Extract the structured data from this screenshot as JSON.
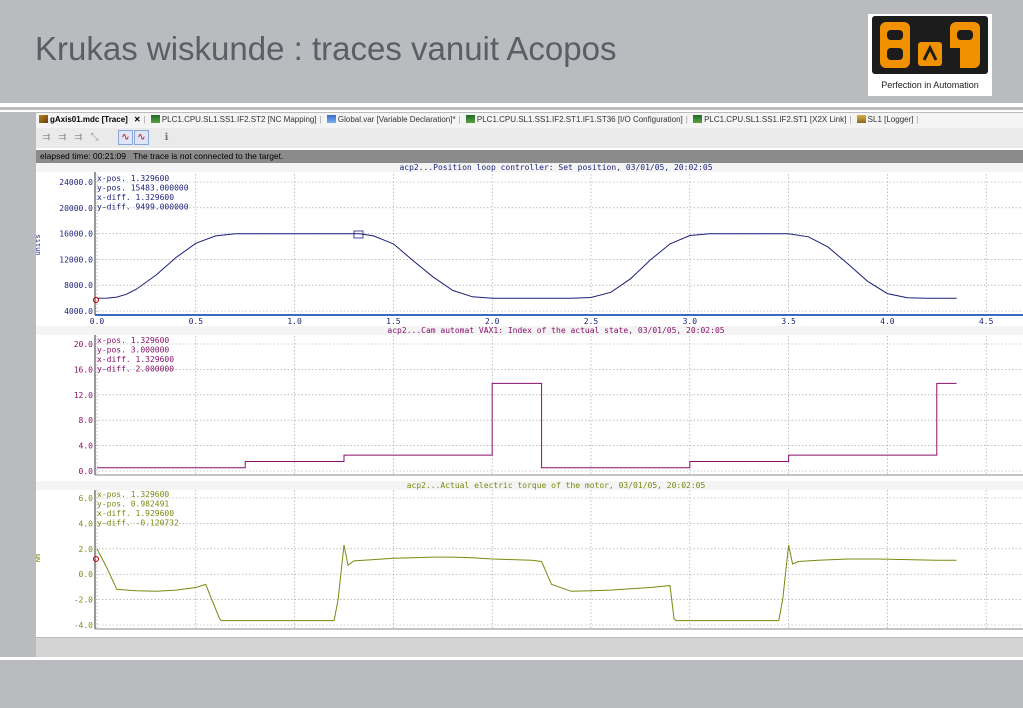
{
  "slide": {
    "title": "Krukas wiskunde : traces vanuit Acopos",
    "logo_tagline": "Perfection in Automation"
  },
  "colors": {
    "plot1": "#1a1f78",
    "plot2": "#8a0f6a",
    "plot3": "#7a8a10",
    "grid": "#9a9a9a",
    "status_bg": "#8b8b8b"
  },
  "tabs": [
    {
      "label": "gAxis01.mdc [Trace]",
      "close": "✕",
      "icon": "trace-icon",
      "active": true
    },
    {
      "label": "PLC1.CPU.SL1.SS1.IF2.ST2 [NC Mapping]",
      "icon": "hardware-icon"
    },
    {
      "label": "Global.var [Variable Declaration]*",
      "icon": "variable-icon"
    },
    {
      "label": "PLC1.CPU.SL1.SS1.IF2.ST1.IF1.ST36 [I/O Configuration]",
      "icon": "hardware-icon"
    },
    {
      "label": "PLC1.CPU.SL1.SS1.IF2.ST1 [X2X Link]",
      "icon": "hardware-icon"
    },
    {
      "label": "SL1 [Logger]",
      "icon": "logger-icon"
    }
  ],
  "toolbar": {
    "buttons": [
      "zoom-in-icon",
      "zoom-out-icon",
      "zoom-reset-icon",
      "cursor-icon",
      "wave-icon",
      "wave-red-icon",
      "info-icon"
    ]
  },
  "status": {
    "elapsed": "elapsed time: 00:21:09",
    "message": "The trace is not connected to the target."
  },
  "chart_data": [
    {
      "type": "line",
      "title": "acp2...Position loop controller: Set position, 03/01/05, 20:02:05",
      "ylabel": "units",
      "yticks": [
        "24000.0",
        "20000.0",
        "16000.0",
        "12000.0",
        "8000.0",
        "4000.0"
      ],
      "xticks": [
        "0.0",
        "0.5",
        "1.0",
        "1.5",
        "2.0",
        "2.5",
        "3.0",
        "3.5",
        "4.0",
        "4.5"
      ],
      "cursor": {
        "x-pos.": "1.329600",
        "y-pos.": "15483.000000",
        "x-diff.": "1.329600",
        "y-diff.": "9499.000000"
      },
      "xlim": [
        0,
        4.5
      ],
      "ylim": [
        4000,
        24000
      ],
      "series": [
        {
          "x": [
            0,
            0.05,
            0.1,
            0.15,
            0.2,
            0.3,
            0.4,
            0.5,
            0.6,
            0.7,
            0.8,
            0.9,
            1.0,
            1.1,
            1.2,
            1.3,
            1.33,
            1.4,
            1.5,
            1.6,
            1.7,
            1.8,
            1.9,
            2.0,
            2.1,
            2.2,
            2.3,
            2.4,
            2.5,
            2.6,
            2.7,
            2.8,
            2.9,
            3.0,
            3.1,
            3.2,
            3.3,
            3.4,
            3.5,
            3.6,
            3.7,
            3.8,
            3.9,
            4.0,
            4.1,
            4.2,
            4.35
          ],
          "y": [
            5984,
            6000,
            6150,
            6600,
            7400,
            9600,
            12300,
            14500,
            15650,
            15984,
            15984,
            15984,
            15984,
            15984,
            15984,
            15984,
            15984,
            15650,
            14400,
            11800,
            9300,
            7200,
            6200,
            5984,
            5984,
            5984,
            5984,
            5984,
            6100,
            6900,
            9000,
            11900,
            14400,
            15700,
            15984,
            15984,
            15984,
            15984,
            15984,
            15500,
            13900,
            11300,
            8600,
            6700,
            6050,
            5984,
            5984
          ]
        }
      ]
    },
    {
      "type": "line",
      "title": "acp2...Cam automat VAX1: Index of the actual state, 03/01/05, 20:02:05",
      "yticks": [
        "20.0",
        "16.0",
        "12.0",
        "8.0",
        "4.0",
        "0.0"
      ],
      "cursor": {
        "x-pos.": "1.329600",
        "y-pos.": "3.000000",
        "x-diff.": "1.329600",
        "y-diff.": "2.000000"
      },
      "xlim": [
        0,
        4.5
      ],
      "ylim": [
        0,
        20
      ],
      "series": [
        {
          "x": [
            0,
            0.75,
            0.75,
            1.25,
            1.25,
            2.0,
            2.0,
            2.25,
            2.25,
            3.0,
            3.0,
            3.5,
            3.5,
            4.25,
            4.25,
            4.35
          ],
          "y": [
            0.5,
            0.5,
            1.5,
            1.5,
            2.5,
            2.5,
            13.8,
            13.8,
            0.5,
            0.5,
            1.5,
            1.5,
            2.5,
            2.5,
            13.8,
            13.8
          ]
        }
      ]
    },
    {
      "type": "line",
      "title": "acp2...Actual electric torque of the motor, 03/01/05, 20:02:05",
      "ylabel": "Nm",
      "yticks": [
        "6.0",
        "4.0",
        "2.0",
        "0.0",
        "-2.0",
        "-4.0"
      ],
      "cursor": {
        "x-pos.": "1.329600",
        "y-pos.": "0.982491",
        "x-diff.": "1.929600",
        "y-diff.": "-0.120732"
      },
      "xlim": [
        0,
        4.5
      ],
      "ylim": [
        -4,
        6
      ],
      "series": [
        {
          "x": [
            0,
            0.05,
            0.1,
            0.2,
            0.3,
            0.4,
            0.5,
            0.55,
            0.62,
            0.63,
            0.9,
            1.2,
            1.22,
            1.25,
            1.27,
            1.3,
            1.4,
            1.5,
            1.6,
            1.7,
            1.8,
            1.9,
            2.0,
            2.1,
            2.2,
            2.25,
            2.3,
            2.4,
            2.5,
            2.6,
            2.7,
            2.8,
            2.9,
            2.92,
            2.93,
            3.2,
            3.45,
            3.47,
            3.5,
            3.52,
            3.55,
            3.65,
            3.8,
            3.95,
            4.1,
            4.25,
            4.35
          ],
          "y": [
            2.0,
            0.5,
            -1.2,
            -1.3,
            -1.35,
            -1.25,
            -1.05,
            -0.8,
            -3.5,
            -3.65,
            -3.65,
            -3.65,
            -2.0,
            2.3,
            0.7,
            1.05,
            1.15,
            1.25,
            1.3,
            1.35,
            1.35,
            1.3,
            1.2,
            1.15,
            1.1,
            1.0,
            -0.8,
            -1.35,
            -1.3,
            -1.25,
            -1.15,
            -1.05,
            -0.9,
            -3.5,
            -3.65,
            -3.65,
            -3.65,
            -2.0,
            2.3,
            0.8,
            1.0,
            1.1,
            1.2,
            1.2,
            1.15,
            1.1,
            1.1
          ]
        }
      ]
    }
  ]
}
